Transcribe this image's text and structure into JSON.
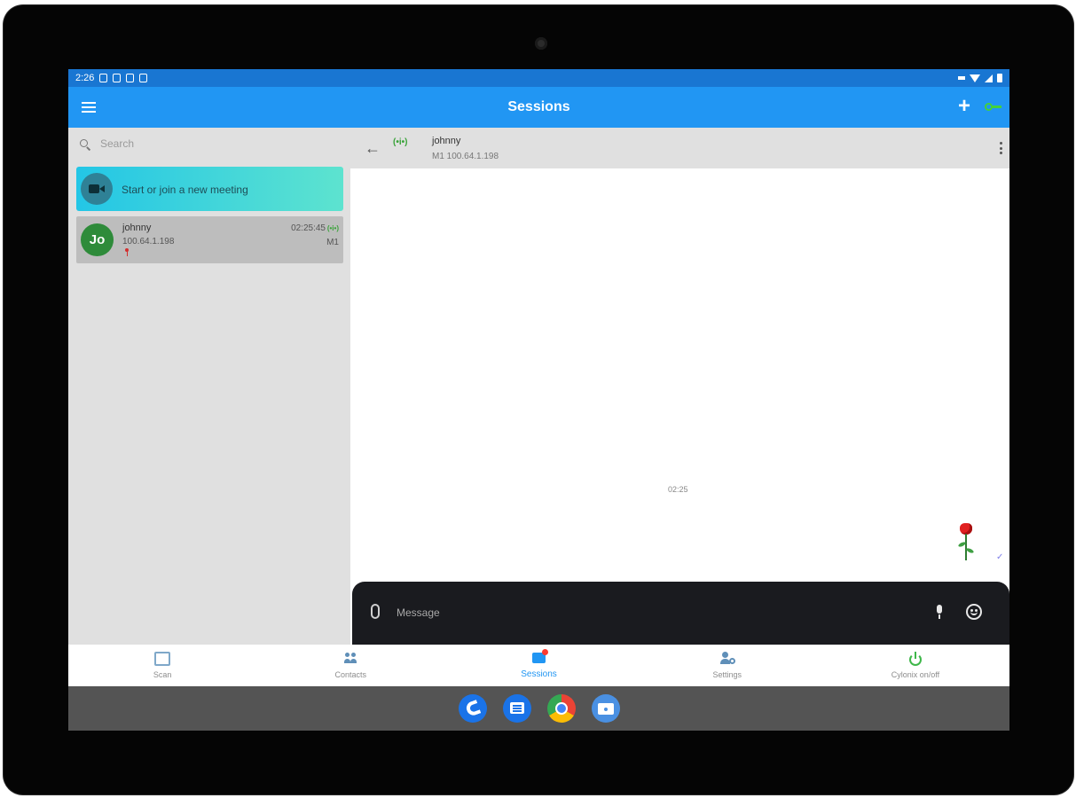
{
  "statusbar": {
    "time": "2:26"
  },
  "appbar": {
    "title": "Sessions",
    "add_label": "+"
  },
  "search": {
    "placeholder": "Search"
  },
  "meeting": {
    "label": "Start or join a new meeting"
  },
  "session": {
    "avatar_initials": "Jo",
    "name": "johnny",
    "ip": "100.64.1.198",
    "time": "02:25:45",
    "signal": "(•i•)",
    "mode": "M1"
  },
  "chat": {
    "back_label": "←",
    "signal": "(•i•)",
    "name": "johnny",
    "subtitle": "M1 100.64.1.198",
    "message_time": "02:25",
    "read_mark": "✓",
    "composer_placeholder": "Message"
  },
  "bottom_nav": [
    {
      "label": "Scan",
      "icon": "scan-icon"
    },
    {
      "label": "Contacts",
      "icon": "contacts-icon"
    },
    {
      "label": "Sessions",
      "icon": "sessions-icon",
      "active": true
    },
    {
      "label": "Settings",
      "icon": "settings-icon"
    },
    {
      "label": "Cylonix on/off",
      "icon": "power-icon"
    }
  ],
  "dock": [
    "phone-app-icon",
    "messages-app-icon",
    "chrome-app-icon",
    "camera-app-icon"
  ],
  "colors": {
    "app_bar": "#2196f3",
    "status_bar": "#1976d2",
    "active_tab": "#2196f3",
    "online_green": "#3aa33a",
    "avatar_green": "#2e8b3a"
  }
}
